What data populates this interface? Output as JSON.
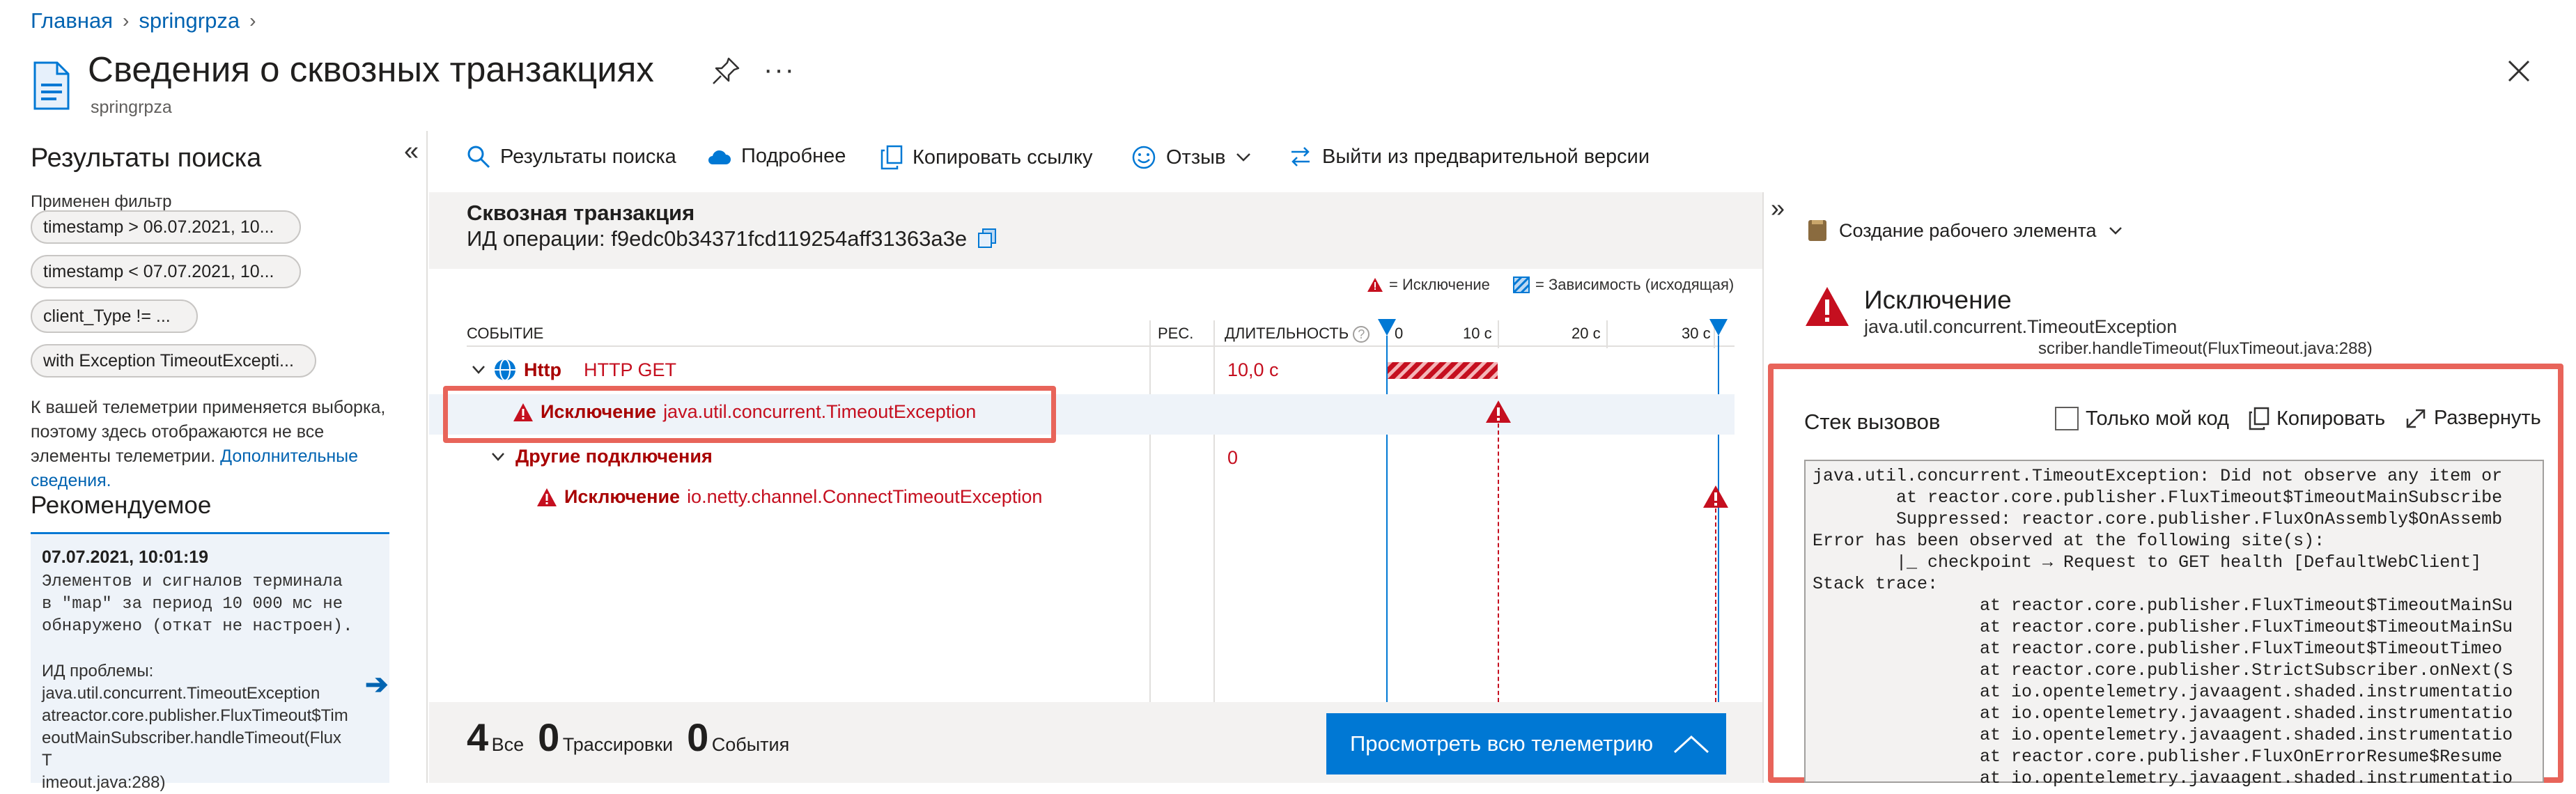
{
  "breadcrumb": {
    "home": "Главная",
    "resource": "springrpza"
  },
  "page": {
    "title": "Сведения о сквозных транзакциях",
    "subtitle": "springrpza"
  },
  "left": {
    "title": "Результаты поиска",
    "filter_label": "Применен фильтр",
    "filters": [
      "timestamp > 06.07.2021, 10...",
      "timestamp < 07.07.2021, 10...",
      "client_Type != ...",
      "with Exception TimeoutExcepti..."
    ],
    "note": "К вашей телеметрии применяется выборка, поэтому здесь отображаются не все элементы телеметрии.",
    "note_link": "Дополнительные сведения.",
    "recommended_title": "Рекомендуемое",
    "rec_date": "07.07.2021, 10:01:19",
    "rec_text": "Элементов и сигналов терминала\nв \"map\" за период 10 000 мс не\nобнаружено (откат не настроен).",
    "rec_issue_label": "ИД проблемы:",
    "rec_issue": "java.util.concurrent.TimeoutException\natreactor.core.publisher.FluxTimeout$Tim\neoutMainSubscriber.handleTimeout(FluxT\nimeout.java:288)"
  },
  "toolbar": {
    "search_results": "Результаты поиска",
    "details": "Подробнее",
    "copy_link": "Копировать ссылку",
    "feedback": "Отзыв",
    "exit_preview": "Выйти из предварительной версии"
  },
  "transaction": {
    "title": "Сквозная транзакция",
    "operation_id": "ИД операции: f9edc0b34371fcd119254aff31363a3e",
    "legend_exception": "= Исключение",
    "legend_dependency": "= Зависимость (исходящая)",
    "col_event": "СОБЫТИЕ",
    "col_res": "РЕС.",
    "col_duration": "ДЛИТЕЛЬНОСТЬ",
    "ticks": [
      "0",
      "10 с",
      "20 с",
      "30 с"
    ],
    "rows": [
      {
        "name": "Http",
        "type": "HTTP GET",
        "duration": "10,0 с"
      },
      {
        "label": "Исключение",
        "exception": "java.util.concurrent.TimeoutException"
      },
      {
        "name": "Другие подключения",
        "duration": "0"
      },
      {
        "label": "Исключение",
        "exception": "io.netty.channel.ConnectTimeoutException"
      }
    ],
    "counts": [
      {
        "num": "4",
        "label": "Все"
      },
      {
        "num": "0",
        "label": "Трассировки"
      },
      {
        "num": "0",
        "label": "События"
      }
    ],
    "view_all": "Просмотреть всю телеметрию"
  },
  "detail": {
    "work_item": "Создание рабочего элемента",
    "exception_title": "Исключение",
    "exception_type": "java.util.concurrent.TimeoutException",
    "cut_line": "scriber.handleTimeout(FluxTimeout.java:288)",
    "callstack_title": "Стек вызовов",
    "just_my_code": "Только мой код",
    "copy": "Копировать",
    "expand": "Развернуть",
    "code": "java.util.concurrent.TimeoutException: Did not observe any item or\n        at reactor.core.publisher.FluxTimeout$TimeoutMainSubscribe\n        Suppressed: reactor.core.publisher.FluxOnAssembly$OnAssemb\nError has been observed at the following site(s):\n        |_ checkpoint → Request to GET health [DefaultWebClient]\nStack trace:\n                at reactor.core.publisher.FluxTimeout$TimeoutMainSu\n                at reactor.core.publisher.FluxTimeout$TimeoutMainSu\n                at reactor.core.publisher.FluxTimeout$TimeoutTimeo\n                at reactor.core.publisher.StrictSubscriber.onNext(S\n                at io.opentelemetry.javaagent.shaded.instrumentatio\n                at io.opentelemetry.javaagent.shaded.instrumentatio\n                at io.opentelemetry.javaagent.shaded.instrumentatio\n                at reactor.core.publisher.FluxOnErrorResume$Resume\n                at io.opentelemetry.javaagent.shaded.instrumentatio"
  }
}
